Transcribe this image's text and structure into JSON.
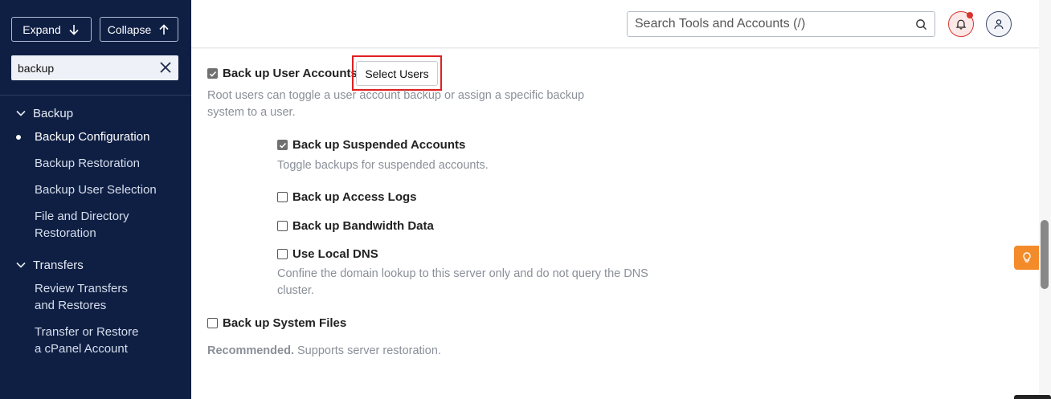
{
  "sidebar": {
    "expand_label": "Expand",
    "collapse_label": "Collapse",
    "filter_value": "backup",
    "groups": [
      {
        "label": "Backup",
        "items": [
          {
            "label": "Backup Configuration",
            "active": true
          },
          {
            "label": "Backup Restoration"
          },
          {
            "label": "Backup User Selection"
          },
          {
            "label": "File and Directory Restoration"
          }
        ]
      },
      {
        "label": "Transfers",
        "items": [
          {
            "label": "Review Transfers and Restores"
          },
          {
            "label": "Transfer or Restore a cPanel Account"
          }
        ]
      }
    ]
  },
  "header": {
    "search_placeholder": "Search Tools and Accounts (/)",
    "icons": [
      "search-icon",
      "bell-icon",
      "user-icon"
    ],
    "notification_color": "#d7342d"
  },
  "main": {
    "backup_user_accounts": {
      "label": "Back up User Accounts",
      "checked": true,
      "button": "Select Users"
    },
    "backup_user_accounts_help": "Root users can toggle a user account backup or assign a specific backup system to a user.",
    "suspended": {
      "label": "Back up Suspended Accounts",
      "checked": true,
      "help": "Toggle backups for suspended accounts."
    },
    "access_logs": {
      "label": "Back up Access Logs",
      "checked": false
    },
    "bandwidth": {
      "label": "Back up Bandwidth Data",
      "checked": false
    },
    "local_dns": {
      "label": "Use Local DNS",
      "checked": false,
      "help": "Confine the domain lookup to this server only and do not query the DNS cluster."
    },
    "system_files": {
      "label": "Back up System Files",
      "checked": false,
      "help_strong": "Recommended.",
      "help": "Supports server restoration."
    }
  },
  "colors": {
    "sidebar_bg": "#0f1f44",
    "highlight": "#e02020",
    "hint": "#f48b2a"
  }
}
